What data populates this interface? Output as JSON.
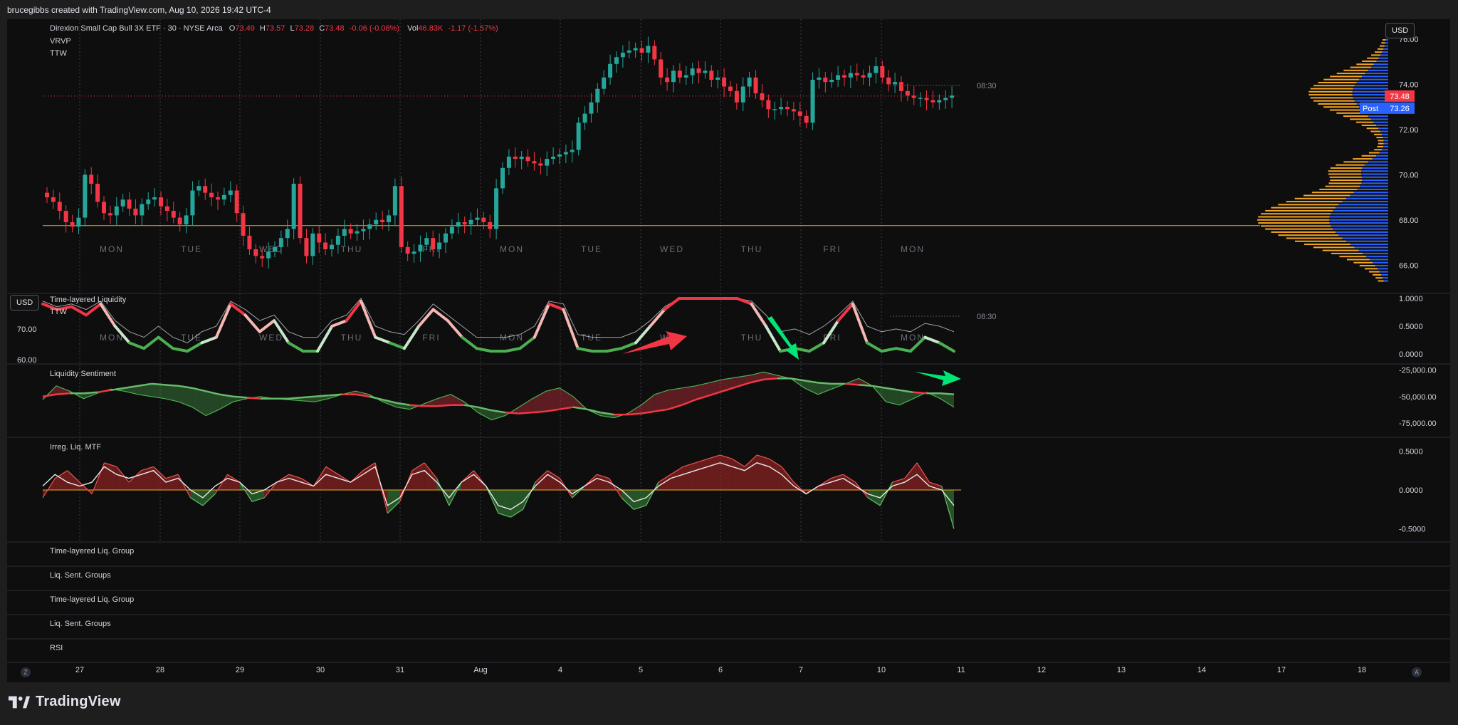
{
  "header": {
    "text": "brucegibbs created with TradingView.com, Aug 10, 2026 19:42 UTC-4"
  },
  "legend": {
    "symbol": "Direxion Small Cap Bull 3X ETF · 30 · NYSE Arca",
    "open_label": "O",
    "open": "73.49",
    "high_label": "H",
    "high": "73.57",
    "low_label": "L",
    "low": "73.28",
    "close_label": "C",
    "close": "73.48",
    "change": "-0.06 (-0.08%)",
    "vol_label": "Vol",
    "vol": "46.83K",
    "vol_change": "-1.17 (-1.57%)",
    "indicators": [
      "VRVP",
      "TTW"
    ]
  },
  "currency": "USD",
  "session_time": "08:30",
  "price_tags": {
    "last": "73.48",
    "post_label": "Post",
    "post": "73.26"
  },
  "colors": {
    "up": "#26a69a",
    "down": "#f23645",
    "vp_up": "#2962ff",
    "vp_down": "#f5a623",
    "liq_green": "#4caf50",
    "liq_red": "#f23645",
    "bg": "#0e0e0e",
    "post_blue": "#2962ff"
  },
  "panes": {
    "tll": {
      "title": "Time-layered Liquidity",
      "subtitle": "TTW"
    },
    "ls": {
      "title": "Liquidity Sentiment"
    },
    "irr": {
      "title": "Irreg. Liq. MTF"
    }
  },
  "group_rows": [
    "Time-layered Liq. Group",
    "Liq. Sent. Groups",
    "Time-layered Liq. Group",
    "Liq. Sent. Groups",
    "RSI"
  ],
  "footer": {
    "brand": "TradingView"
  },
  "corner_left": "Z",
  "corner_right": "A",
  "chart_data": [
    {
      "type": "candlestick",
      "title": "Direxion Small Cap Bull 3X ETF · 30 · NYSE Arca",
      "ylim": [
        65,
        76.5
      ],
      "yticks": [
        "76.00",
        "74.00",
        "72.00",
        "70.00",
        "68.00",
        "66.00"
      ],
      "ytick_values": [
        76,
        74,
        72,
        70,
        68,
        66
      ],
      "xticks": [
        "27",
        "28",
        "29",
        "30",
        "31",
        "Aug",
        "4",
        "5",
        "6",
        "7",
        "10",
        "11",
        "12",
        "13",
        "14",
        "17",
        "18"
      ],
      "day_labels": [
        "MON",
        "TUE",
        "WED",
        "THU",
        "FRI",
        "MON",
        "TUE",
        "WED",
        "THU",
        "FRI",
        "MON"
      ],
      "reference_lines": {
        "last_price": 73.48,
        "support": 67.75
      },
      "closes": [
        69.0,
        68.8,
        68.4,
        67.9,
        67.7,
        68.1,
        70.0,
        69.6,
        68.8,
        68.3,
        68.2,
        68.6,
        68.9,
        68.5,
        68.2,
        68.7,
        68.9,
        69.0,
        68.6,
        68.4,
        68.1,
        67.8,
        68.2,
        69.3,
        69.5,
        69.2,
        69.0,
        68.9,
        69.1,
        69.3,
        68.3,
        67.3,
        66.7,
        66.4,
        66.3,
        66.6,
        66.8,
        67.2,
        67.6,
        69.6,
        67.2,
        66.4,
        67.4,
        67.0,
        66.7,
        66.9,
        67.3,
        67.6,
        67.4,
        67.5,
        67.6,
        67.8,
        68.0,
        67.9,
        68.2,
        69.5,
        66.8,
        66.5,
        66.6,
        66.9,
        67.2,
        66.7,
        67.0,
        67.4,
        67.7,
        67.9,
        67.8,
        68.0,
        68.1,
        67.9,
        67.6,
        69.4,
        70.3,
        70.8,
        70.7,
        70.8,
        70.6,
        70.5,
        70.4,
        70.7,
        70.8,
        70.9,
        71.0,
        71.1,
        72.3,
        72.7,
        73.2,
        73.8,
        74.3,
        74.9,
        75.2,
        75.4,
        75.5,
        75.6,
        75.4,
        75.7,
        75.1,
        74.3,
        74.1,
        74.6,
        74.3,
        74.4,
        74.7,
        74.5,
        74.6,
        74.2,
        74.3,
        73.9,
        73.7,
        73.2,
        73.9,
        74.3,
        73.6,
        73.3,
        72.9,
        72.9,
        73.0,
        72.9,
        72.8,
        72.6,
        72.3,
        74.2,
        74.3,
        74.1,
        74.2,
        74.4,
        74.3,
        74.5,
        74.4,
        74.3,
        74.5,
        74.8,
        74.3,
        74.0,
        74.1,
        73.7,
        73.5,
        73.4,
        73.4,
        73.3,
        73.2,
        73.3,
        73.4,
        73.5
      ]
    },
    {
      "type": "line",
      "title": "Time-layered Liquidity",
      "ylim": [
        0,
        1
      ],
      "yticks": [
        "1.0000",
        "0.5000",
        "0.0000"
      ],
      "ytick_values": [
        1,
        0.5,
        0
      ],
      "left_axis_ticks": [
        "70.00",
        "60.00"
      ],
      "series": [
        {
          "values": [
            0.9,
            0.8,
            0.85,
            0.7,
            0.9,
            0.5,
            0.2,
            0.1,
            0.3,
            0.1,
            0.05,
            0.2,
            0.3,
            0.9,
            0.7,
            0.4,
            0.6,
            0.2,
            0.05,
            0.05,
            0.5,
            0.6,
            0.95,
            0.3,
            0.2,
            0.1,
            0.5,
            0.8,
            0.6,
            0.3,
            0.1,
            0.05,
            0.05,
            0.1,
            0.3,
            0.9,
            0.8,
            0.1,
            0.05,
            0.05,
            0.1,
            0.2,
            0.5,
            0.8,
            1.0,
            1.0,
            1.0,
            1.0,
            1.0,
            0.9,
            0.5,
            0.05,
            0.1,
            0.05,
            0.2,
            0.6,
            0.9,
            0.2,
            0.05,
            0.1,
            0.05,
            0.3,
            0.2,
            0.05
          ]
        },
        {
          "values": [
            0.95,
            0.85,
            0.9,
            0.8,
            0.95,
            0.6,
            0.4,
            0.3,
            0.5,
            0.3,
            0.2,
            0.4,
            0.5,
            0.95,
            0.8,
            0.6,
            0.7,
            0.4,
            0.3,
            0.3,
            0.6,
            0.7,
            1.0,
            0.5,
            0.4,
            0.35,
            0.6,
            0.9,
            0.7,
            0.5,
            0.3,
            0.3,
            0.3,
            0.35,
            0.5,
            0.95,
            0.9,
            0.35,
            0.3,
            0.3,
            0.3,
            0.4,
            0.6,
            0.85,
            1.0,
            1.0,
            1.0,
            1.0,
            1.0,
            0.95,
            0.7,
            0.4,
            0.45,
            0.35,
            0.5,
            0.7,
            0.95,
            0.5,
            0.4,
            0.45,
            0.4,
            0.55,
            0.5,
            0.4
          ]
        }
      ]
    },
    {
      "type": "area",
      "title": "Liquidity Sentiment",
      "ylim": [
        -85000,
        -20000
      ],
      "yticks": [
        "-25,000.00",
        "-50,000.00",
        "-75,000.00"
      ],
      "ytick_values": [
        -25000,
        -50000,
        -75000
      ],
      "series": [
        {
          "values": [
            -53000,
            -40000,
            -45000,
            -52000,
            -47000,
            -43000,
            -45000,
            -48000,
            -50000,
            -52000,
            -55000,
            -60000,
            -68000,
            -62000,
            -55000,
            -52000,
            -50000,
            -52000,
            -53000,
            -54000,
            -55000,
            -52000,
            -48000,
            -45000,
            -48000,
            -55000,
            -60000,
            -62000,
            -57000,
            -52000,
            -48000,
            -55000,
            -65000,
            -72000,
            -68000,
            -60000,
            -52000,
            -45000,
            -42000,
            -50000,
            -62000,
            -68000,
            -70000,
            -66000,
            -58000,
            -48000,
            -44000,
            -42000,
            -40000,
            -37000,
            -34000,
            -32000,
            -30000,
            -27000,
            -30000,
            -33000,
            -42000,
            -48000,
            -43000,
            -38000,
            -33000,
            -40000,
            -55000,
            -58000,
            -52000,
            -46000,
            -52000,
            -60000
          ]
        },
        {
          "values": [
            -50000,
            -48000,
            -47000,
            -47000,
            -46000,
            -44000,
            -42000,
            -40000,
            -38000,
            -39000,
            -40000,
            -42000,
            -45000,
            -48000,
            -50000,
            -51000,
            -52000,
            -52000,
            -52000,
            -51000,
            -50000,
            -49000,
            -48000,
            -48000,
            -50000,
            -53000,
            -56000,
            -58000,
            -59000,
            -59000,
            -58000,
            -58000,
            -60000,
            -63000,
            -65000,
            -66000,
            -65000,
            -64000,
            -62000,
            -60000,
            -62000,
            -65000,
            -67000,
            -67000,
            -66000,
            -64000,
            -62000,
            -58000,
            -53000,
            -49000,
            -45000,
            -41000,
            -37000,
            -34000,
            -33000,
            -33000,
            -35000,
            -37000,
            -38000,
            -38000,
            -39000,
            -40000,
            -42000,
            -44000,
            -46000,
            -47000,
            -47000,
            -48000
          ]
        }
      ]
    },
    {
      "type": "area",
      "title": "Irreg. Liq. MTF",
      "ylim": [
        -0.55,
        0.55
      ],
      "yticks": [
        "0.5000",
        "0.0000",
        "-0.5000"
      ],
      "ytick_values": [
        0.5,
        0,
        -0.5
      ],
      "series": [
        {
          "values": [
            -0.1,
            0.15,
            0.25,
            0.1,
            -0.05,
            0.35,
            0.3,
            0.1,
            0.25,
            0.3,
            0.15,
            0.2,
            -0.1,
            -0.2,
            -0.05,
            0.2,
            0.1,
            -0.15,
            -0.1,
            0.1,
            0.2,
            0.15,
            0.05,
            0.3,
            0.2,
            0.1,
            0.25,
            0.35,
            -0.3,
            -0.15,
            0.25,
            0.35,
            0.15,
            -0.2,
            0.1,
            0.25,
            0.05,
            -0.3,
            -0.35,
            -0.25,
            0.1,
            0.25,
            0.15,
            -0.1,
            0.05,
            0.2,
            0.15,
            -0.1,
            -0.25,
            -0.2,
            0.1,
            0.2,
            0.3,
            0.35,
            0.4,
            0.45,
            0.4,
            0.3,
            0.45,
            0.4,
            0.3,
            0.1,
            -0.05,
            0.05,
            0.15,
            0.2,
            0.1,
            -0.1,
            -0.2,
            0.1,
            0.15,
            0.35,
            0.1,
            0.05,
            -0.5
          ]
        },
        {
          "values": [
            0.05,
            0.2,
            0.1,
            0.05,
            0.1,
            0.3,
            0.2,
            0.15,
            0.2,
            0.25,
            0.1,
            0.15,
            0.0,
            -0.1,
            0.05,
            0.15,
            0.1,
            -0.05,
            0.0,
            0.1,
            0.15,
            0.1,
            0.05,
            0.2,
            0.15,
            0.1,
            0.2,
            0.3,
            -0.2,
            -0.1,
            0.2,
            0.25,
            0.1,
            -0.1,
            0.1,
            0.2,
            0.05,
            -0.2,
            -0.25,
            -0.15,
            0.05,
            0.2,
            0.1,
            -0.05,
            0.05,
            0.15,
            0.1,
            0.0,
            -0.15,
            -0.1,
            0.05,
            0.15,
            0.2,
            0.25,
            0.3,
            0.35,
            0.3,
            0.25,
            0.35,
            0.3,
            0.2,
            0.05,
            -0.05,
            0.05,
            0.1,
            0.15,
            0.05,
            -0.05,
            -0.1,
            0.05,
            0.1,
            0.2,
            0.05,
            0.0,
            -0.2
          ]
        }
      ]
    }
  ]
}
